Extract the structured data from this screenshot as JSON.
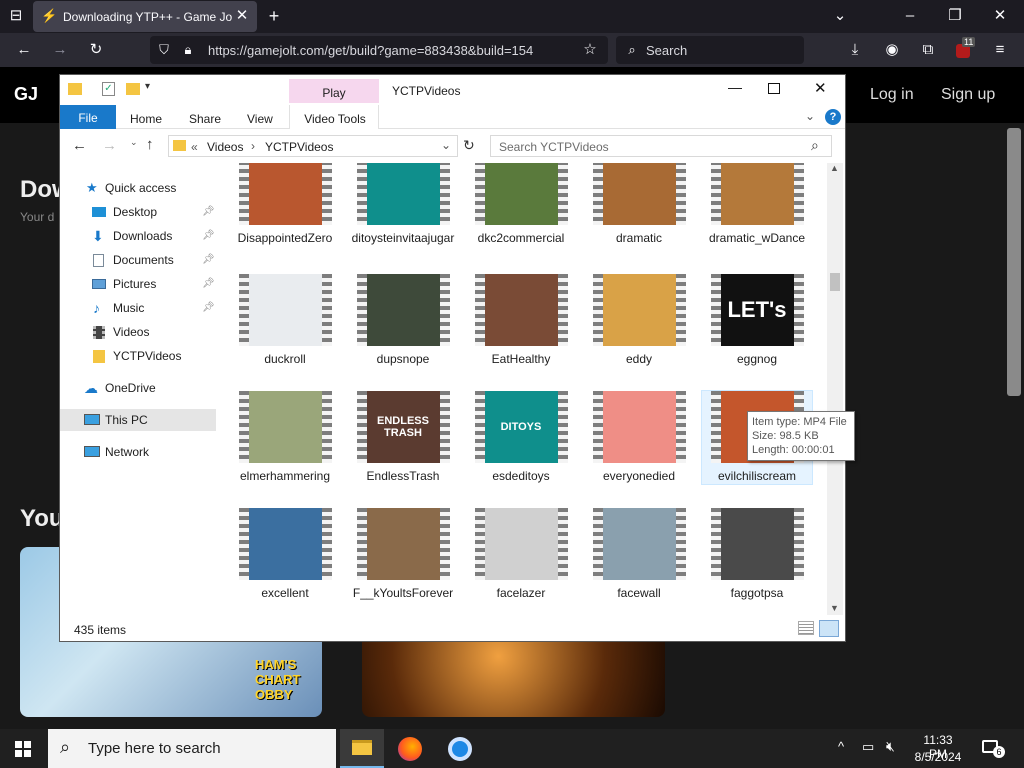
{
  "browser": {
    "tab_title": "Downloading YTP++ - Game Jolt",
    "url": "https://gamejolt.com/get/build?game=883438&build=154",
    "search_placeholder": "Search",
    "extension_badge": "11"
  },
  "site": {
    "logo": "GJ",
    "login": "Log in",
    "signup": "Sign up",
    "heading_partial": "Dow",
    "sub_partial": "Your d",
    "section_partial": "You",
    "card_text": "HAM'S CHART OBBY"
  },
  "explorer": {
    "window_title": "YCTPVideos",
    "contextual_tab": "Play",
    "ribbon_tabs": [
      "File",
      "Home",
      "Share",
      "View",
      "Video Tools"
    ],
    "breadcrumb": [
      "Videos",
      "YCTPVideos"
    ],
    "breadcrumb_prefix": "«",
    "search_placeholder": "Search YCTPVideos",
    "nav": {
      "quick_access": "Quick access",
      "desktop": "Desktop",
      "downloads": "Downloads",
      "documents": "Documents",
      "pictures": "Pictures",
      "music": "Music",
      "videos": "Videos",
      "yctpvideos": "YCTPVideos",
      "onedrive": "OneDrive",
      "thispc": "This PC",
      "network": "Network"
    },
    "files": [
      {
        "name": "DisappointedZero",
        "color": "#b9572f"
      },
      {
        "name": "ditoysteinvitaajugar",
        "color": "#0f8f8c"
      },
      {
        "name": "dkc2commercial",
        "color": "#5a7a3c"
      },
      {
        "name": "dramatic",
        "color": "#a86a34"
      },
      {
        "name": "dramatic_wDance",
        "color": "#b4793a"
      },
      {
        "name": "duckroll",
        "color": "#e9ecef"
      },
      {
        "name": "dupsnope",
        "color": "#3e4a3a"
      },
      {
        "name": "EatHealthy",
        "color": "#7a4b36"
      },
      {
        "name": "eddy",
        "color": "#d9a247"
      },
      {
        "name": "eggnog",
        "color": "#111111",
        "label": "LET's"
      },
      {
        "name": "elmerhammering",
        "color": "#9aa67a"
      },
      {
        "name": "EndlessTrash",
        "color": "#5b3b30",
        "label": "ENDLESS TRASH"
      },
      {
        "name": "esdeditoys",
        "color": "#0f8f8c",
        "label": "DITOYS"
      },
      {
        "name": "everyonedied",
        "color": "#ef8e86"
      },
      {
        "name": "evilchiliscream",
        "color": "#c4562c"
      },
      {
        "name": "excellent",
        "color": "#3b6fa0"
      },
      {
        "name": "F__kYoultsForever",
        "color": "#8a6a4a"
      },
      {
        "name": "facelazer",
        "color": "#d0d0d0"
      },
      {
        "name": "facewall",
        "color": "#8aa0ae"
      },
      {
        "name": "faggotpsa",
        "color": "#4a4a4a"
      }
    ],
    "tooltip": {
      "type": "Item type: MP4 File",
      "size": "Size: 98.5 KB",
      "length": "Length: 00:00:01"
    },
    "status": "435 items"
  },
  "taskbar": {
    "search_placeholder": "Type here to search",
    "time": "11:33 PM",
    "date": "8/5/2024",
    "notification_count": "6"
  }
}
